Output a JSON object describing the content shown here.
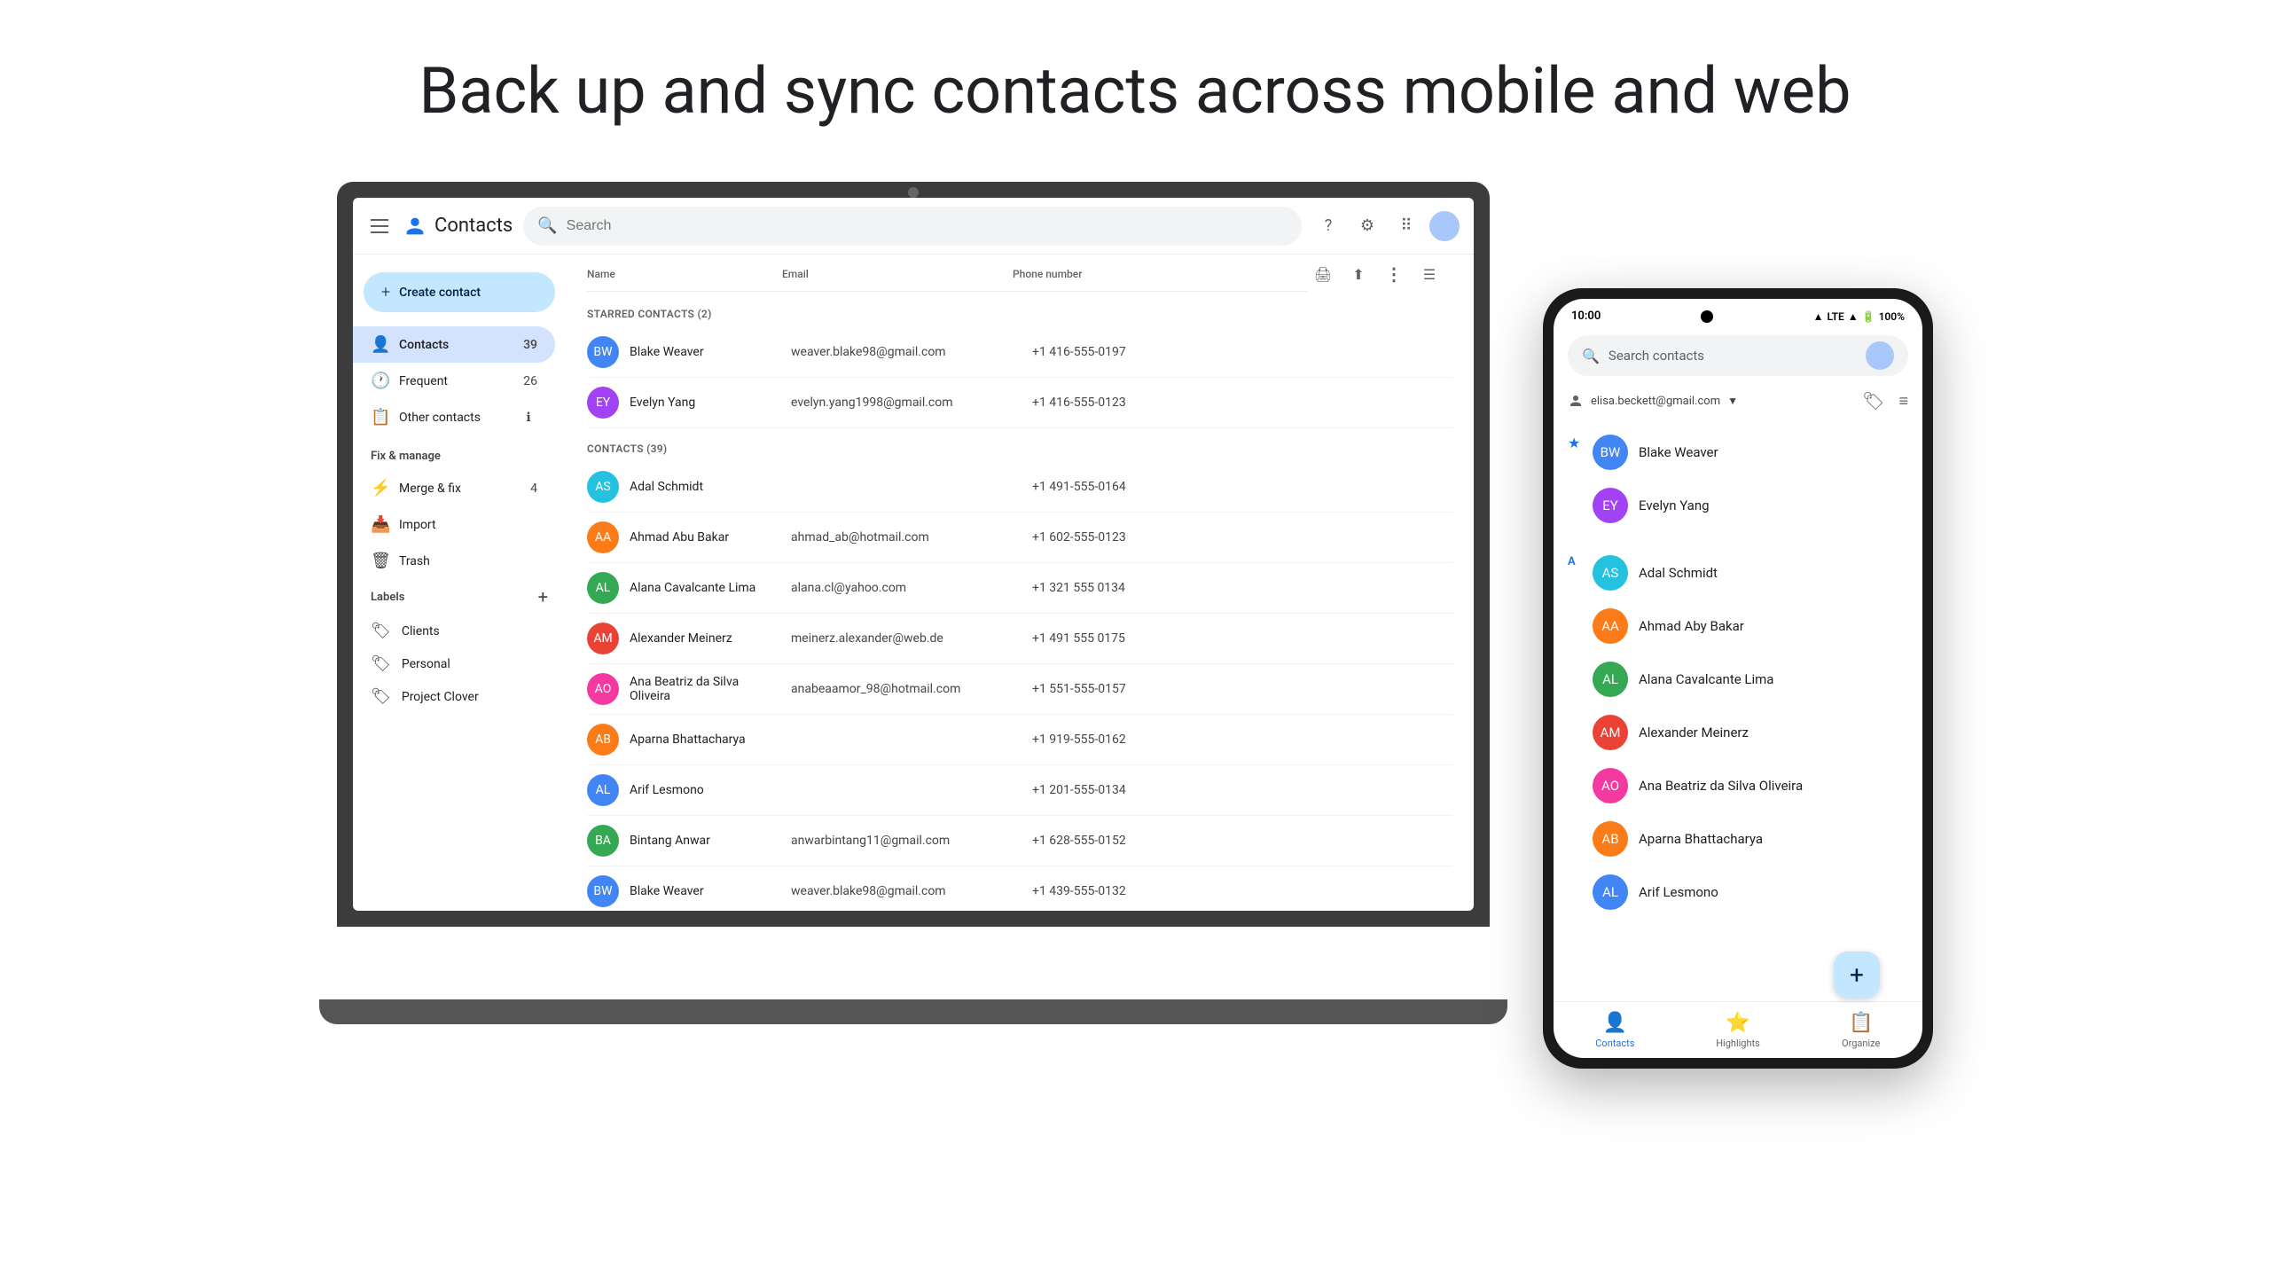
{
  "page": {
    "title": "Back up and sync contacts across mobile and web"
  },
  "desktop_app": {
    "app_name": "Contacts",
    "search_placeholder": "Search",
    "header_icons": [
      "help-icon",
      "settings-icon",
      "apps-icon"
    ],
    "toolbar_icons": [
      "print-icon",
      "export-icon",
      "more-icon",
      "list-icon"
    ],
    "create_contact_label": "Create contact",
    "nav_items": [
      {
        "label": "Contacts",
        "count": "39",
        "active": true
      },
      {
        "label": "Frequent",
        "count": "26",
        "active": false
      },
      {
        "label": "Other contacts",
        "count": "",
        "active": false
      }
    ],
    "fix_manage_title": "Fix & manage",
    "fix_manage_items": [
      {
        "label": "Merge & fix",
        "count": "4"
      },
      {
        "label": "Import",
        "count": ""
      },
      {
        "label": "Trash",
        "count": ""
      }
    ],
    "labels_title": "Labels",
    "labels": [
      {
        "label": "Clients"
      },
      {
        "label": "Personal"
      },
      {
        "label": "Project Clover"
      }
    ],
    "table_headers": {
      "name": "Name",
      "email": "Email",
      "phone": "Phone number"
    },
    "starred_section": "STARRED CONTACTS (2)",
    "contacts_section": "CONTACTS (39)",
    "starred_contacts": [
      {
        "name": "Blake Weaver",
        "email": "weaver.blake98@gmail.com",
        "phone": "+1 416-555-0197",
        "color": "av-blue"
      },
      {
        "name": "Evelyn Yang",
        "email": "evelyn.yang1998@gmail.com",
        "phone": "+1 416-555-0123",
        "color": "av-purple"
      }
    ],
    "contacts": [
      {
        "name": "Adal Schmidt",
        "email": "",
        "phone": "+1 491-555-0164",
        "color": "av-teal"
      },
      {
        "name": "Ahmad Abu Bakar",
        "email": "ahmad_ab@hotmail.com",
        "phone": "+1 602-555-0123",
        "color": "av-orange"
      },
      {
        "name": "Alana Cavalcante Lima",
        "email": "alana.cl@yahoo.com",
        "phone": "+1 321 555 0134",
        "color": "av-green"
      },
      {
        "name": "Alexander Meinerz",
        "email": "meinerz.alexander@web.de",
        "phone": "+1 491 555 0175",
        "color": "av-red"
      },
      {
        "name": "Ana Beatriz da Silva Oliveira",
        "email": "anabeaamor_98@hotmail.com",
        "phone": "+1 551-555-0157",
        "color": "av-pink"
      },
      {
        "name": "Aparna Bhattacharya",
        "email": "",
        "phone": "+1 919-555-0162",
        "color": "av-orange"
      },
      {
        "name": "Arif Lesmono",
        "email": "",
        "phone": "+1 201-555-0134",
        "color": "av-blue"
      },
      {
        "name": "Bintang Anwar",
        "email": "anwarbintang11@gmail.com",
        "phone": "+1 628-555-0152",
        "color": "av-green"
      },
      {
        "name": "Blake Weaver",
        "email": "weaver.blake98@gmail.com",
        "phone": "+1 439-555-0132",
        "color": "av-blue"
      }
    ]
  },
  "mobile_app": {
    "time": "10:00",
    "status": {
      "lte": "LTE",
      "battery": "100%"
    },
    "search_placeholder": "Search contacts",
    "account_email": "elisa.beckett@gmail.com",
    "starred_contacts": [
      {
        "name": "Blake Weaver",
        "color": "av-blue"
      },
      {
        "name": "Evelyn Yang",
        "color": "av-purple"
      }
    ],
    "contacts": [
      {
        "name": "Adal Schmidt",
        "color": "av-teal"
      },
      {
        "name": "Ahmad Aby Bakar",
        "color": "av-orange"
      },
      {
        "name": "Alana Cavalcante Lima",
        "color": "av-green"
      },
      {
        "name": "Alexander Meinerz",
        "color": "av-red"
      },
      {
        "name": "Ana Beatriz da Silva Oliveira",
        "color": "av-pink"
      },
      {
        "name": "Aparna Bhattacharya",
        "color": "av-orange"
      },
      {
        "name": "Arif Lesmono",
        "color": "av-blue"
      }
    ],
    "bottom_nav": [
      {
        "label": "Contacts",
        "active": true
      },
      {
        "label": "Highlights",
        "active": false
      },
      {
        "label": "Organize",
        "active": false
      }
    ],
    "fab_label": "+"
  }
}
